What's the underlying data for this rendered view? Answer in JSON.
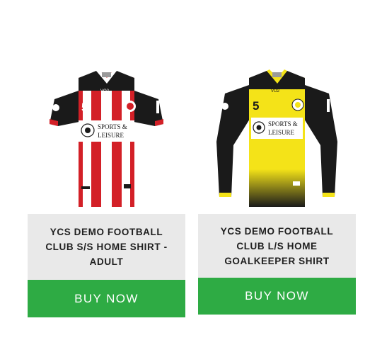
{
  "products": [
    {
      "name": "YCS DEMO FOOTBALL CLUB S/S HOME SHIRT - ADULT",
      "button_label": "BUY NOW",
      "shirt_number": "5",
      "sponsor_line1": "SPORTS &",
      "sponsor_line2": "LEISURE",
      "brand": "VO2"
    },
    {
      "name": "YCS DEMO FOOTBALL CLUB L/S HOME GOALKEEPER SHIRT",
      "button_label": "BUY NOW",
      "shirt_number": "5",
      "sponsor_line1": "SPORTS &",
      "sponsor_line2": "LEISURE",
      "brand": "VO2"
    }
  ],
  "colors": {
    "button_green": "#2eab44",
    "name_box_bg": "#e9e9e9",
    "home_red": "#d32027",
    "keeper_yellow": "#f4e318",
    "black": "#1a1a1a"
  }
}
